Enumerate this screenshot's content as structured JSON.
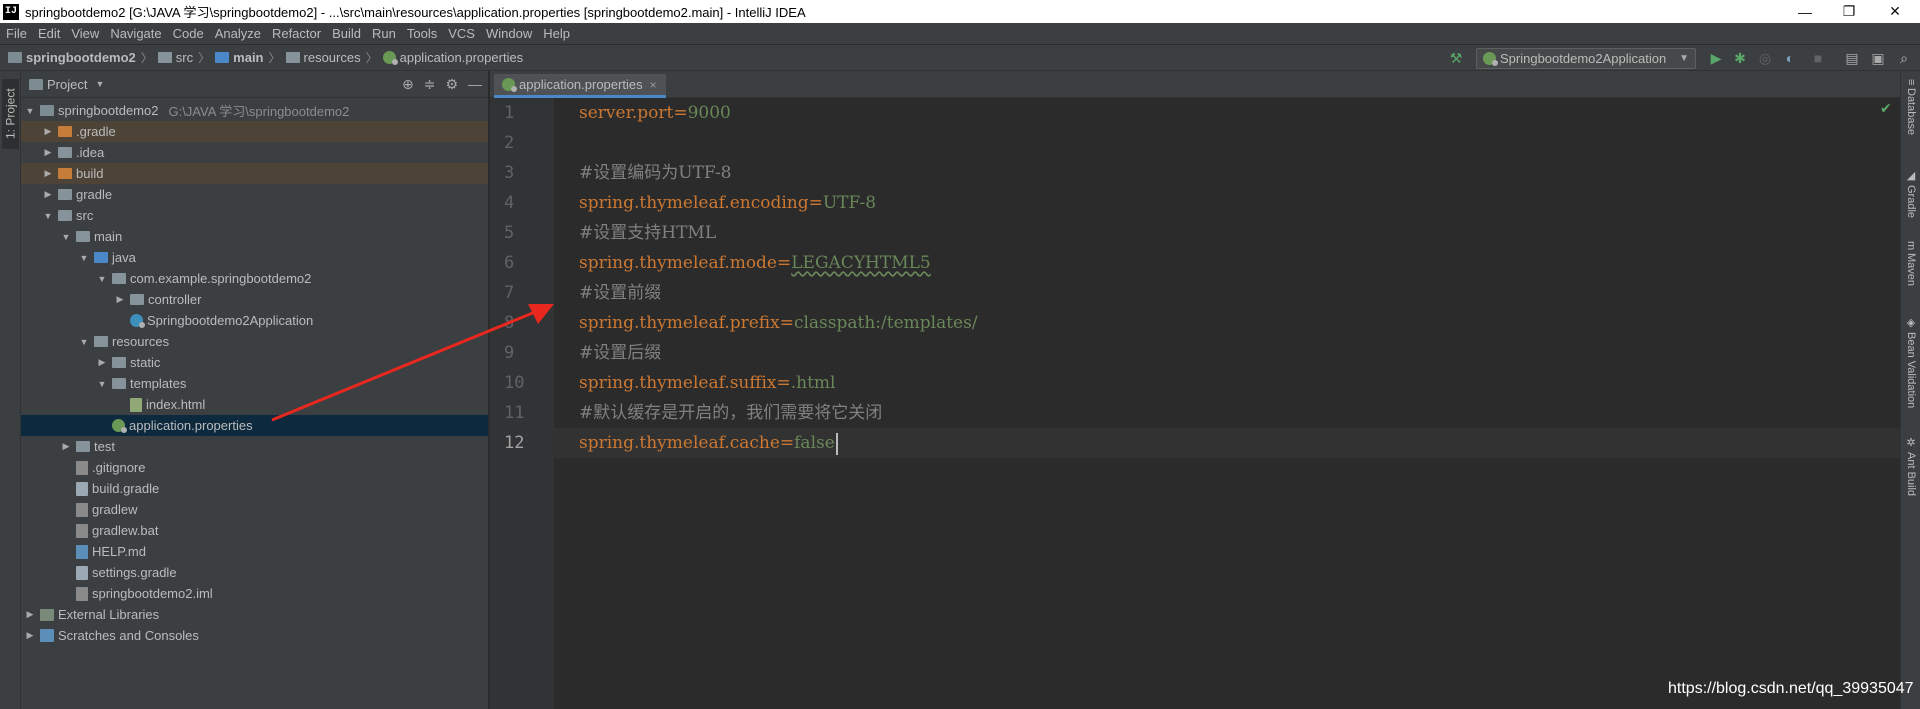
{
  "window": {
    "title": "springbootdemo2 [G:\\JAVA 学习\\springbootdemo2] - ...\\src\\main\\resources\\application.properties [springbootdemo2.main] - IntelliJ IDEA",
    "app_icon": "IJ",
    "controls": {
      "minimize": "—",
      "restore": "❐",
      "close": "✕"
    }
  },
  "menu": [
    "File",
    "Edit",
    "View",
    "Navigate",
    "Code",
    "Analyze",
    "Refactor",
    "Build",
    "Run",
    "Tools",
    "VCS",
    "Window",
    "Help"
  ],
  "breadcrumb": [
    "springbootdemo2",
    "src",
    "main",
    "resources",
    "application.properties"
  ],
  "toolbar": {
    "run_config": "Springbootdemo2Application",
    "icons": [
      "hammer-icon",
      "run-icon",
      "debug-icon",
      "coverage-icon",
      "profile-icon",
      "stop-icon",
      "project-structure-icon",
      "layout-icon",
      "search-icon"
    ]
  },
  "left_strip": {
    "project_tab": "1: Project"
  },
  "project_panel": {
    "title": "Project",
    "tree": [
      {
        "label": "springbootdemo2",
        "hint": "G:\\JAVA 学习\\springbootdemo2",
        "state": "open"
      },
      {
        "label": ".gradle",
        "state": "closed"
      },
      {
        "label": ".idea",
        "state": "closed"
      },
      {
        "label": "build",
        "state": "closed"
      },
      {
        "label": "gradle",
        "state": "closed"
      },
      {
        "label": "src",
        "state": "open"
      },
      {
        "label": "main",
        "state": "open"
      },
      {
        "label": "java",
        "state": "open"
      },
      {
        "label": "com.example.springbootdemo2",
        "state": "open"
      },
      {
        "label": "controller",
        "state": "closed"
      },
      {
        "label": "Springbootdemo2Application",
        "state": "leaf"
      },
      {
        "label": "resources",
        "state": "open"
      },
      {
        "label": "static",
        "state": "closed"
      },
      {
        "label": "templates",
        "state": "open"
      },
      {
        "label": "index.html",
        "state": "leaf"
      },
      {
        "label": "application.properties",
        "state": "leaf"
      },
      {
        "label": "test",
        "state": "closed"
      },
      {
        "label": ".gitignore",
        "state": "leaf"
      },
      {
        "label": "build.gradle",
        "state": "leaf"
      },
      {
        "label": "gradlew",
        "state": "leaf"
      },
      {
        "label": "gradlew.bat",
        "state": "leaf"
      },
      {
        "label": "HELP.md",
        "state": "leaf"
      },
      {
        "label": "settings.gradle",
        "state": "leaf"
      },
      {
        "label": "springbootdemo2.iml",
        "state": "leaf"
      },
      {
        "label": "External Libraries",
        "state": "closed"
      },
      {
        "label": "Scratches and Consoles",
        "state": "closed"
      }
    ],
    "selected": "application.properties"
  },
  "editor": {
    "tab_label": "application.properties",
    "tab_close": "×",
    "lines": [
      {
        "n": "1",
        "key": "server.port",
        "eq": "=",
        "val": "9000"
      },
      {
        "n": "2"
      },
      {
        "n": "3",
        "comment": "#设置编码为UTF-8"
      },
      {
        "n": "4",
        "key": "spring.thymeleaf.encoding",
        "eq": "=",
        "val": "UTF-8"
      },
      {
        "n": "5",
        "comment": "#设置支持HTML"
      },
      {
        "n": "6",
        "key": "spring.thymeleaf.mode",
        "eq": "=",
        "val": "LEGACYHTML5"
      },
      {
        "n": "7",
        "comment": "#设置前缀"
      },
      {
        "n": "8",
        "key": "spring.thymeleaf.prefix",
        "eq": "=",
        "val": "classpath:/templates/"
      },
      {
        "n": "9",
        "comment": "#设置后缀"
      },
      {
        "n": "10",
        "key": "spring.thymeleaf.suffix",
        "eq": "=",
        "val": ".html"
      },
      {
        "n": "11",
        "comment": "#默认缓存是开启的，我们需要将它关闭"
      },
      {
        "n": "12",
        "key": "spring.thymeleaf.cache",
        "eq": "=",
        "val": "false"
      }
    ],
    "current_line": "12"
  },
  "right_strip": [
    "Database",
    "Gradle",
    "Maven",
    "Bean Validation",
    "Ant Build"
  ],
  "watermark": "https://blog.csdn.net/qq_39935047",
  "colors": {
    "key": "#cc7832",
    "value": "#6a8759",
    "comment": "#808080",
    "annotation_arrow": "#e8281e"
  }
}
